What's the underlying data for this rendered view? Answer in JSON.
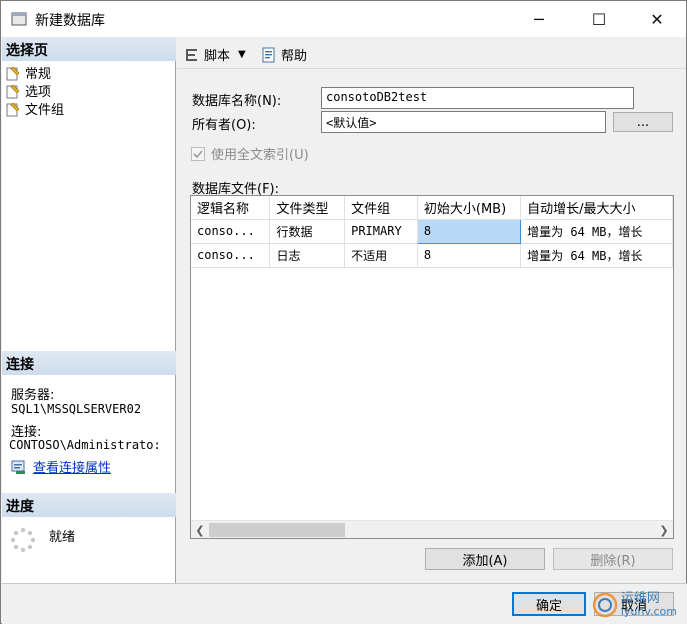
{
  "window": {
    "title": "新建数据库",
    "controls": {
      "minimize": "─",
      "maximize": "☐",
      "close": "✕"
    }
  },
  "left": {
    "select_page_header": "选择页",
    "pages": [
      {
        "label": "常规",
        "icon": "page-wrench-icon"
      },
      {
        "label": "选项",
        "icon": "page-wrench-icon"
      },
      {
        "label": "文件组",
        "icon": "page-wrench-icon"
      }
    ],
    "connection_header": "连接",
    "server_label": "服务器:",
    "server_value": "SQL1\\MSSQLSERVER02",
    "connection_label": "连接:",
    "connection_value": "CONTOSO\\Administrato:",
    "view_props_link": "查看连接属性",
    "progress_header": "进度",
    "progress_status": "就绪"
  },
  "toolbar": {
    "script_label": "脚本",
    "help_label": "帮助"
  },
  "form": {
    "db_name_label": "数据库名称(N):",
    "db_name_value": "consotoDB2test",
    "owner_label": "所有者(O):",
    "owner_value": "<默认值>",
    "browse_label": "...",
    "fulltext_label": "使用全文索引(U)",
    "files_label": "数据库文件(F):"
  },
  "files_table": {
    "columns": [
      "逻辑名称",
      "文件类型",
      "文件组",
      "初始大小(MB)",
      "自动增长/最大大小"
    ],
    "rows": [
      [
        "conso...",
        "行数据",
        "PRIMARY",
        "8",
        "增量为 64 MB，增长"
      ],
      [
        "conso...",
        "日志",
        "不适用",
        "8",
        "增量为 64 MB，增长"
      ]
    ]
  },
  "buttons": {
    "add": "添加(A)",
    "remove": "删除(R)",
    "ok": "确定",
    "cancel": "取消"
  },
  "watermark": {
    "brand": "运维网",
    "site": "iyunv.com"
  },
  "colors": {
    "accent": "#0078d7",
    "selected_cell": "#b9d9f7",
    "section_header": "#cfdced",
    "link": "#0033cc"
  }
}
